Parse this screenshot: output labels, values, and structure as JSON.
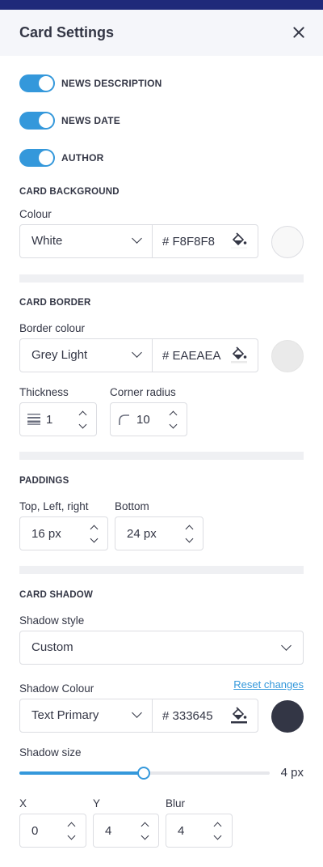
{
  "panel": {
    "title": "Card Settings"
  },
  "toggles": [
    {
      "label": "NEWS DESCRIPTION",
      "on": true
    },
    {
      "label": "NEWS DATE",
      "on": true
    },
    {
      "label": "AUTHOR",
      "on": true
    }
  ],
  "card_background": {
    "title": "CARD BACKGROUND",
    "colour_label": "Colour",
    "colour_name": "White",
    "hex": "# F8F8F8",
    "swatch_color": "#F8F8F8"
  },
  "card_border": {
    "title": "CARD BORDER",
    "colour_label": "Border colour",
    "colour_name": "Grey Light",
    "hex": "# EAEAEA",
    "swatch_color": "#EAEAEA",
    "thickness_label": "Thickness",
    "thickness": "1",
    "radius_label": "Corner radius",
    "radius": "10"
  },
  "paddings": {
    "title": "PADDINGS",
    "top_lr_label": "Top, Left, right",
    "top_lr": "16 px",
    "bottom_label": "Bottom",
    "bottom": "24 px"
  },
  "card_shadow": {
    "title": "CARD SHADOW",
    "style_label": "Shadow style",
    "style_value": "Custom",
    "colour_label": "Shadow Colour",
    "reset_label": "Reset changes",
    "colour_name": "Text Primary",
    "hex": "# 333645",
    "swatch_color": "#333645",
    "size_label": "Shadow size",
    "size_value": "4 px",
    "size_fraction": 0.497,
    "x_label": "X",
    "x": "0",
    "y_label": "Y",
    "y": "4",
    "blur_label": "Blur",
    "blur": "4"
  },
  "colors": {
    "accent": "#3498db",
    "header_bar": "#1f2a7a",
    "text": "#333645"
  }
}
